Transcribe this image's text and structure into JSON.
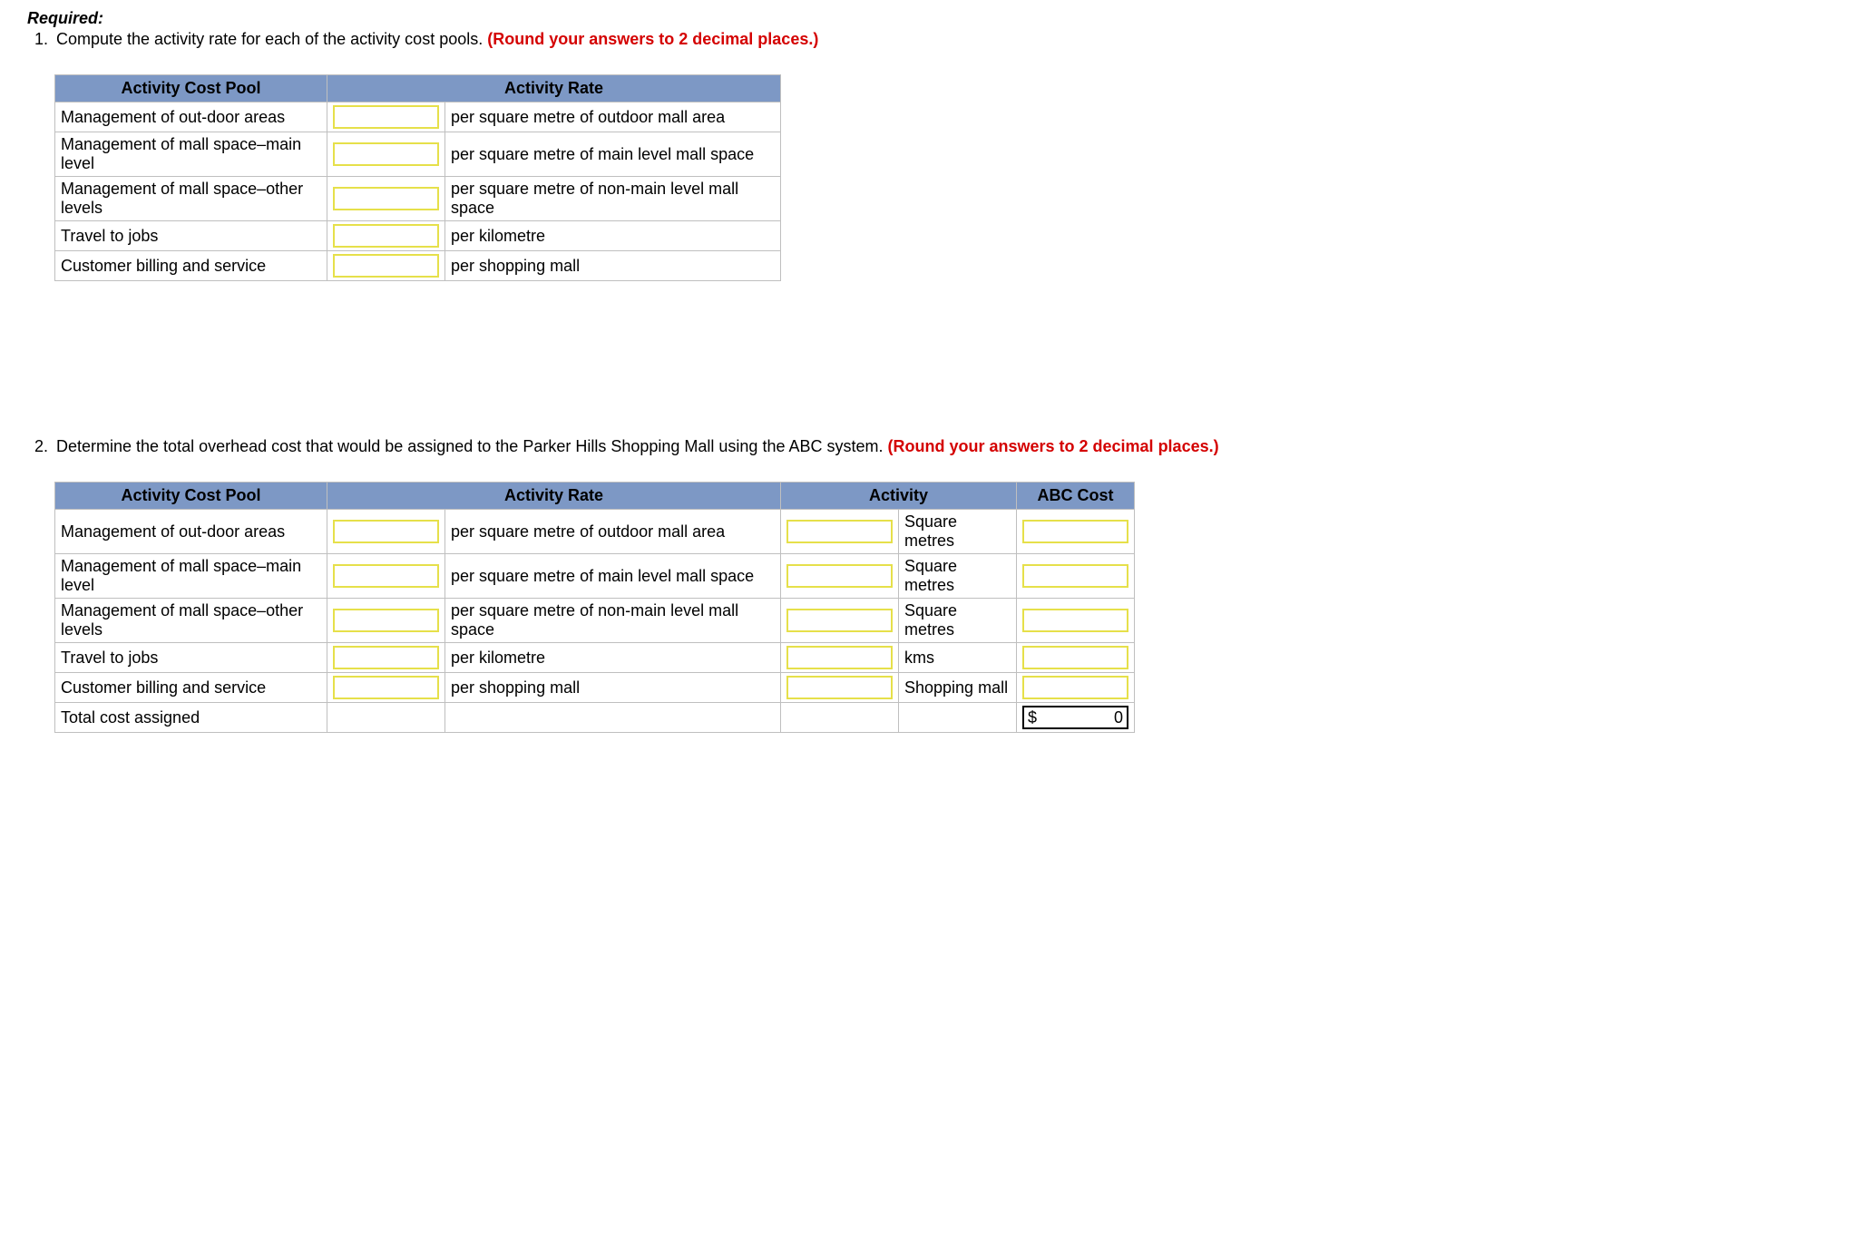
{
  "labels": {
    "required": "Required:"
  },
  "q1": {
    "text_plain": "Compute the activity rate for each of the activity cost pools. ",
    "round_note": "(Round your answers to 2 decimal places.)"
  },
  "q2": {
    "text_plain": "Determine the total overhead cost that would be assigned to the Parker Hills Shopping Mall using the ABC system. ",
    "round_note": "(Round your answers to 2 decimal places.)"
  },
  "headers": {
    "pool": "Activity Cost Pool",
    "rate": "Activity Rate",
    "activity": "Activity",
    "abc": "ABC Cost"
  },
  "rows": [
    {
      "pool": "Management of out-door areas",
      "rate_unit": "per square metre of outdoor mall area",
      "activity_unit": "Square metres"
    },
    {
      "pool": "Management of mall space–main level",
      "rate_unit": "per square metre of main level mall space",
      "activity_unit": "Square metres"
    },
    {
      "pool": "Management of mall space–other levels",
      "rate_unit": "per square metre of non-main level mall space",
      "activity_unit": "Square metres"
    },
    {
      "pool": "Travel to jobs",
      "rate_unit": "per kilometre",
      "activity_unit": "kms"
    },
    {
      "pool": "Customer billing and service",
      "rate_unit": "per shopping mall",
      "activity_unit": "Shopping mall"
    }
  ],
  "total_row": {
    "label": "Total cost assigned",
    "currency": "$",
    "value": "0"
  }
}
